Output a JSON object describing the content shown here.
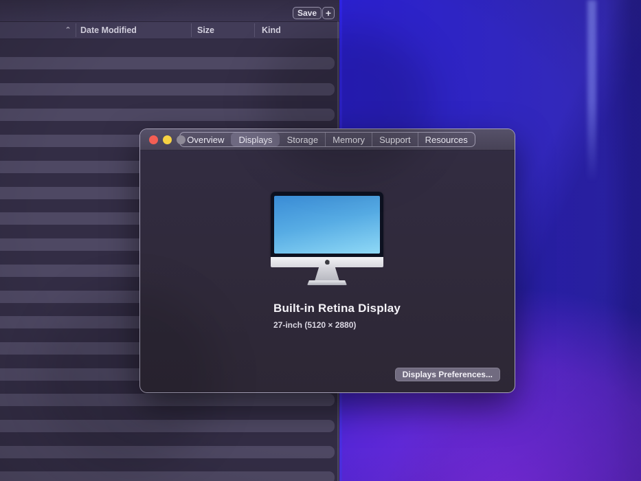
{
  "finder": {
    "toolbar": {
      "save_label": "Save",
      "add_label": "+"
    },
    "sort_indicator": "⌃",
    "columns": [
      {
        "label": "Date Modified"
      },
      {
        "label": "Size"
      },
      {
        "label": "Kind"
      }
    ]
  },
  "about_window": {
    "tabs": [
      {
        "label": "Overview",
        "selected": false
      },
      {
        "label": "Displays",
        "selected": true
      },
      {
        "label": "Storage",
        "selected": false
      },
      {
        "label": "Memory",
        "selected": false
      },
      {
        "label": "Support",
        "selected": false
      },
      {
        "label": "Resources",
        "selected": false
      }
    ],
    "display": {
      "name": "Built-in Retina Display",
      "resolution": "27-inch (5120 × 2880)"
    },
    "preferences_button_label": "Displays Preferences..."
  },
  "colors": {
    "traffic_close": "#f35e54",
    "traffic_minimize": "#f6d243",
    "traffic_zoom_disabled": "#8e8a97",
    "wallpaper_blue": "#2b20d0",
    "wallpaper_purple": "#7e2ce4",
    "imac_screen_blue": "#57ace4",
    "window_body": "#2f2939"
  }
}
